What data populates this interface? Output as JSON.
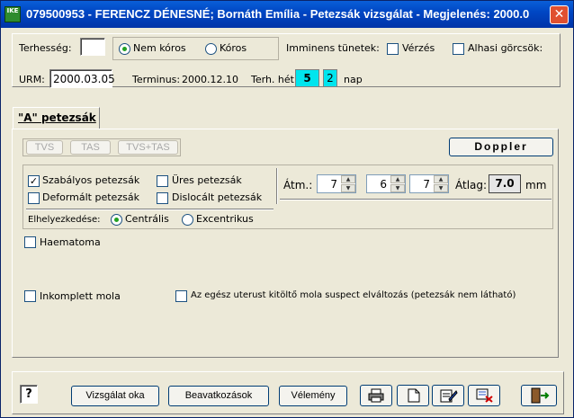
{
  "window": {
    "app_icon_text": "IKE",
    "title": "079500953 - FERENCZ DÉNESNÉ; Bornáth Emília - Petezsák vizsgálat - Megjelenés: 2000.0...",
    "close_label": "✕"
  },
  "header": {
    "terhesseg_label": "Terhesség:",
    "terhesseg_value": "",
    "nem_koros_label": "Nem kóros",
    "koros_label": "Kóros",
    "imminens_label": "Imminens tünetek:",
    "verzes_label": "Vérzés",
    "alhasi_label": "Alhasi görcsök:",
    "urm_label": "URM:",
    "urm_value": "2000.03.05",
    "terminus_label": "Terminus:",
    "terminus_value": "2000.12.10",
    "terh_het_label": "Terh. hét:",
    "terh_het_week": "5",
    "terh_het_day": "2",
    "nap_label": "nap"
  },
  "tab": {
    "label": "\"A\" petezsák"
  },
  "modes": {
    "tvs": "TVS",
    "tas": "TAS",
    "tvs_tas": "TVS+TAS"
  },
  "doppler_label": "Doppler",
  "petezsak": {
    "szabalyos_label": "Szabályos petezsák",
    "szabalyos_checked": true,
    "ures_label": "Üres petezsák",
    "deformalt_label": "Deformált petezsák",
    "dislocalt_label": "Dislocált petezsák",
    "elhelyezkedes_label": "Elhelyezkedése:",
    "centralis_label": "Centrális",
    "excentrikus_label": "Excentrikus",
    "atm_label": "Átm.:",
    "atm_values": [
      "7",
      "6",
      "7"
    ],
    "atlag_label": "Átlag:",
    "atlag_value": "7.0",
    "mm_label": "mm"
  },
  "findings": {
    "haematoma_label": "Haematoma",
    "inkomplett_label": "Inkomplett mola",
    "egesz_uterus_label": "Az egész uterust kitöltő mola suspect elváltozás (petezsák nem látható)"
  },
  "footer": {
    "help_label": "?",
    "vizsgalat_label": "Vizsgálat oka",
    "beavatkozasok_label": "Beavatkozások",
    "velemeny_label": "Vélemény"
  }
}
